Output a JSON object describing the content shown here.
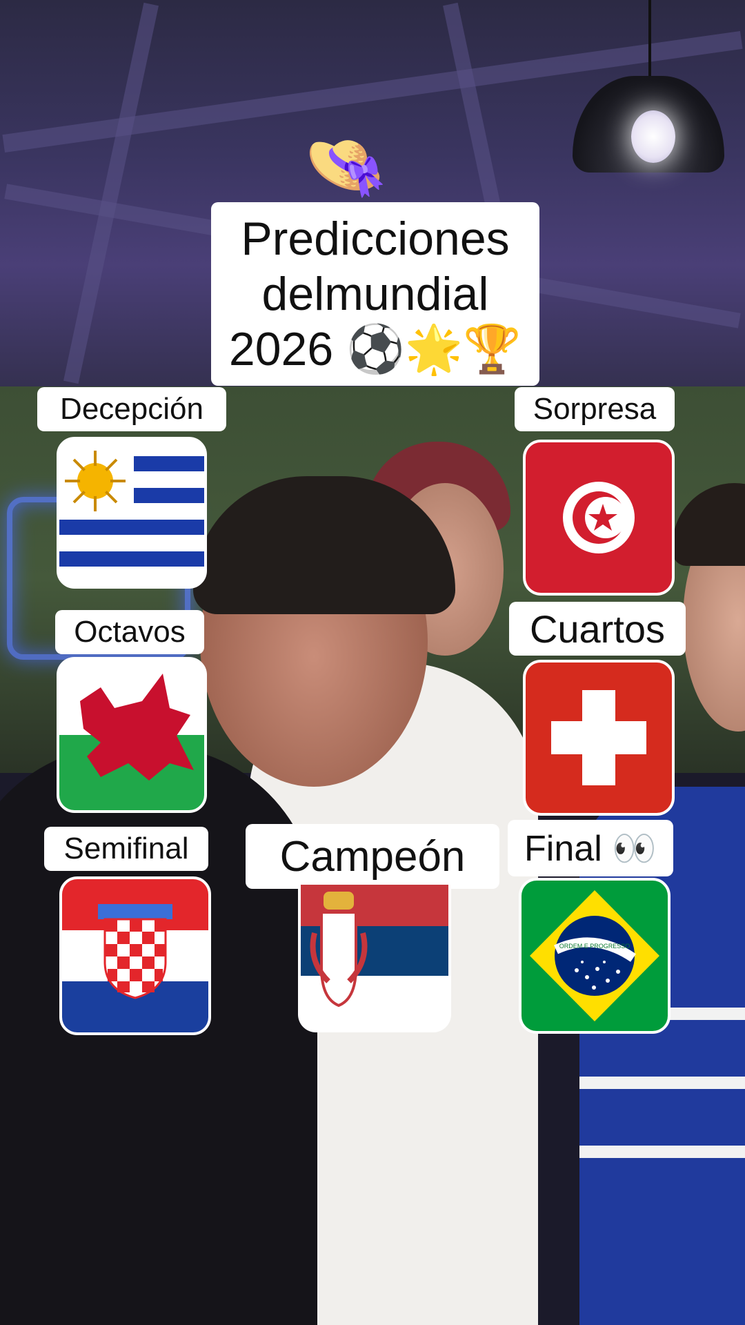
{
  "title": {
    "hat_emoji": "👒",
    "line1": "Predicciones",
    "line2": "delmundial",
    "line3": "2026 ⚽🌟🏆"
  },
  "picks": {
    "decepcion": {
      "label": "Decepción",
      "flag_icon": "uruguay-flag"
    },
    "sorpresa": {
      "label": "Sorpresa",
      "flag_icon": "tunisia-flag"
    },
    "octavos": {
      "label": "Octavos",
      "flag_icon": "wales-flag"
    },
    "cuartos": {
      "label": "Cuartos",
      "flag_icon": "switzerland-flag"
    },
    "semifinal": {
      "label": "Semifinal",
      "flag_icon": "croatia-flag"
    },
    "campeon": {
      "label": "Campeón",
      "flag_icon": "serbia-flag"
    },
    "final": {
      "label": "Final 👀",
      "flag_icon": "brazil-flag"
    }
  },
  "brazil_motto": "ORDEM E PROGRESSO",
  "colors": {
    "label_bg": "#ffffff",
    "text": "#111111",
    "uruguay_blue": "#1a3ba8",
    "tunisia_red": "#d21e2e",
    "swiss_red": "#d52b1e",
    "wales_green": "#20a84a",
    "wales_red": "#c8102e",
    "croatia_red": "#e3262b",
    "croatia_blue": "#1a3f9e",
    "serbia_red": "#c6363c",
    "serbia_blue": "#0c4076",
    "brazil_green": "#009c3b",
    "brazil_yellow": "#ffdf00",
    "brazil_blue": "#002776"
  }
}
